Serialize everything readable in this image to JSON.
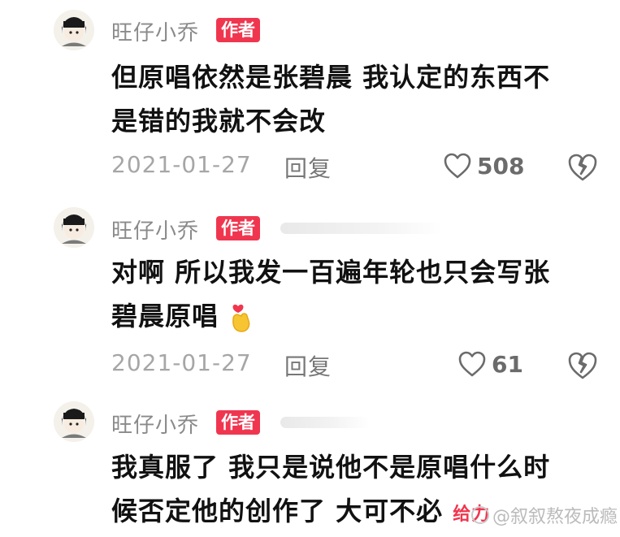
{
  "comments": [
    {
      "author": "旺仔小乔",
      "badge": "作者",
      "text_line1": "但原唱依然是张碧晨 我认定的东西不",
      "text_line2": "是错的我就不会改",
      "date": "2021-01-27",
      "reply_label": "回复",
      "likes": "508"
    },
    {
      "author": "旺仔小乔",
      "badge": "作者",
      "text_line1": "对啊 所以我发一百遍年轮也只会写张",
      "text_line2": "碧晨原唱",
      "date": "2021-01-27",
      "reply_label": "回复",
      "likes": "61"
    },
    {
      "author": "旺仔小乔",
      "badge": "作者",
      "text_line1": "我真服了 我只是说他不是原唱什么时",
      "text_line2": "候否定他的创作了 大可不必",
      "text_tail": "给力"
    }
  ],
  "watermark": "@叙叙熬夜成瘾",
  "icons": {
    "like": "heart-outline-icon",
    "dislike": "broken-heart-icon",
    "emoji": "finger-heart-emoji-icon",
    "watermark_logo": "weibo-logo-icon"
  },
  "colors": {
    "badge": "#f0364f",
    "meta_text": "#a6a6a6"
  }
}
